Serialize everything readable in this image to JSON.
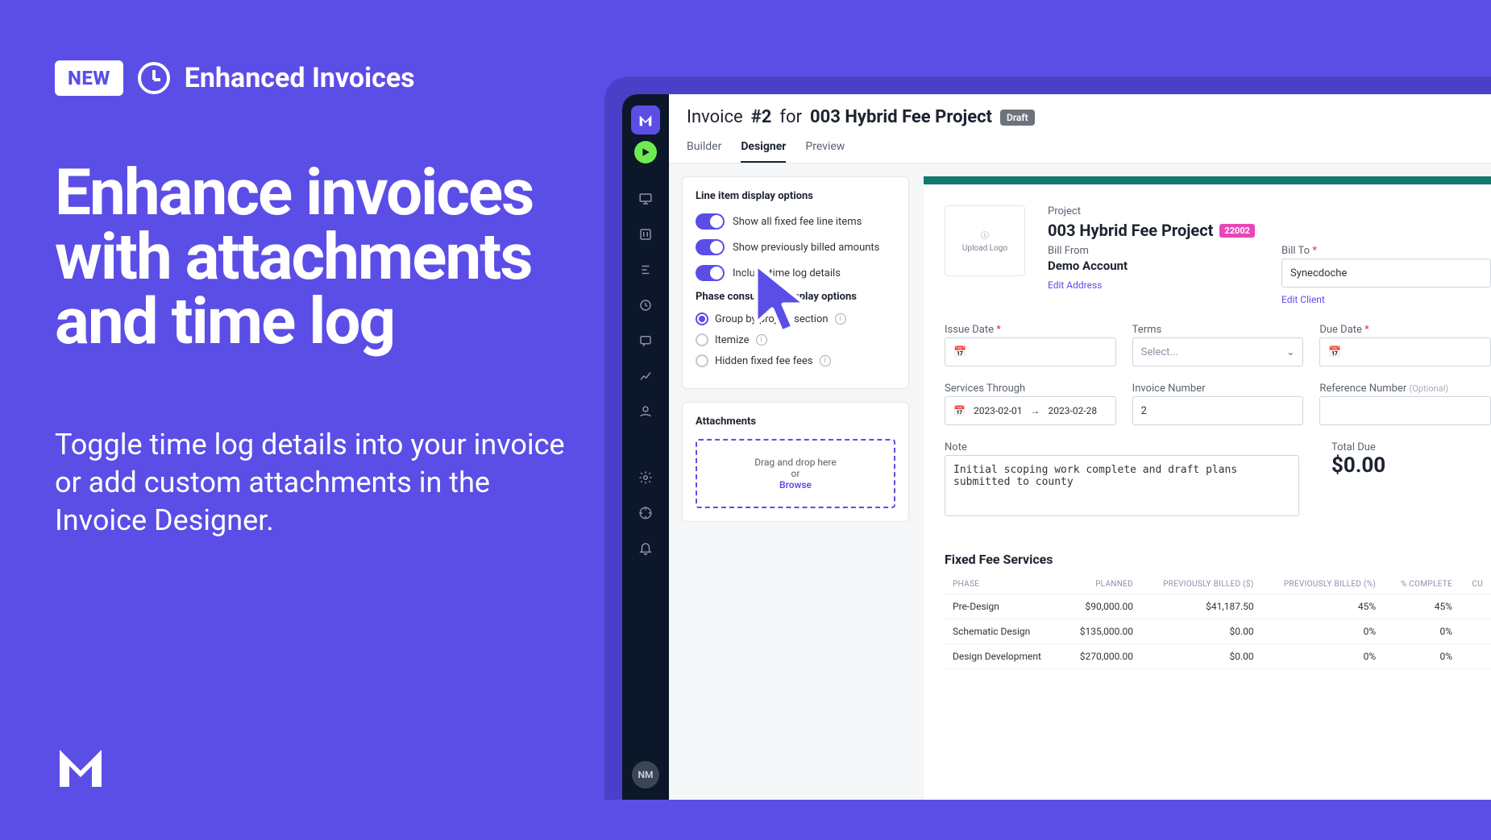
{
  "promo": {
    "new_badge": "NEW",
    "label": "Enhanced Invoices",
    "headline": "Enhance invoices with attachments and time log",
    "subtitle": "Toggle time log details into your invoice or add custom attachments in the Invoice Designer."
  },
  "sidenav": {
    "avatar": "NM"
  },
  "header": {
    "prefix": "Invoice",
    "number": "#2",
    "mid": "for",
    "project": "003 Hybrid Fee Project",
    "status": "Draft"
  },
  "tabs": {
    "builder": "Builder",
    "designer": "Designer",
    "preview": "Preview"
  },
  "options": {
    "title": "Line item display options",
    "toggle1": "Show all fixed fee line items",
    "toggle2": "Show previously billed amounts",
    "toggle3": "Include time log details",
    "phase_title": "Phase consultants display options",
    "radio1": "Group by project section",
    "radio2": "Itemize",
    "radio3": "Hidden fixed fee fees"
  },
  "attachments": {
    "title": "Attachments",
    "drop_line": "Drag and drop here",
    "or": "or",
    "browse": "Browse"
  },
  "invoice": {
    "upload_logo": "Upload Logo",
    "project_label": "Project",
    "project_name": "003 Hybrid Fee Project",
    "project_code": "22002",
    "bill_from_label": "Bill From",
    "bill_from_value": "Demo Account",
    "edit_address": "Edit Address",
    "bill_to_label": "Bill To",
    "bill_to_value": "Synecdoche",
    "edit_client": "Edit Client",
    "issue_date_label": "Issue Date",
    "terms_label": "Terms",
    "terms_placeholder": "Select...",
    "due_date_label": "Due Date",
    "services_through_label": "Services Through",
    "services_from": "2023-02-01",
    "services_to": "2023-02-28",
    "invoice_number_label": "Invoice Number",
    "invoice_number_value": "2",
    "reference_label": "Reference Number",
    "optional": "(Optional)",
    "note_label": "Note",
    "note_value": "Initial scoping work complete and draft plans submitted to county",
    "total_due_label": "Total Due",
    "total_due_value": "$0.00",
    "section_title": "Fixed Fee Services",
    "table": {
      "headers": {
        "phase": "PHASE",
        "planned": "PLANNED",
        "prev_dollar": "PREVIOUSLY BILLED ($)",
        "prev_pct": "PREVIOUSLY BILLED (%)",
        "pct_complete": "% COMPLETE",
        "cu": "CU"
      },
      "rows": [
        {
          "phase": "Pre-Design",
          "planned": "$90,000.00",
          "prev_dollar": "$41,187.50",
          "prev_pct": "45%",
          "pct_complete": "45%"
        },
        {
          "phase": "Schematic Design",
          "planned": "$135,000.00",
          "prev_dollar": "$0.00",
          "prev_pct": "0%",
          "pct_complete": "0%"
        },
        {
          "phase": "Design Development",
          "planned": "$270,000.00",
          "prev_dollar": "$0.00",
          "prev_pct": "0%",
          "pct_complete": "0%"
        }
      ]
    }
  }
}
